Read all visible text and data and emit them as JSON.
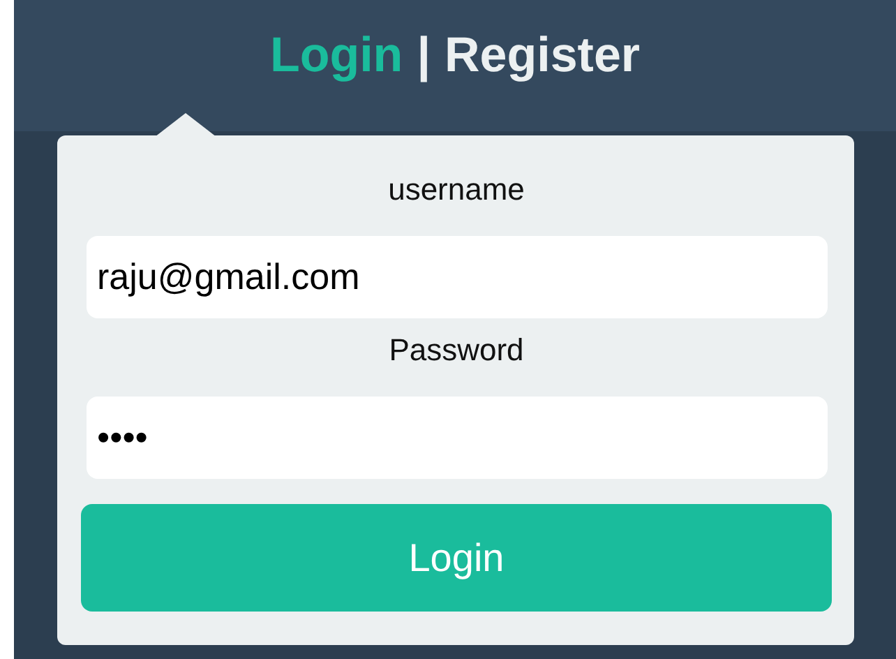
{
  "tabs": [
    {
      "label": "Login",
      "selected": true
    },
    {
      "label": "Register",
      "selected": false
    }
  ],
  "tab_separator": "|",
  "form": {
    "fields": [
      {
        "label": "username",
        "value": "raju@gmail.com"
      },
      {
        "label": "Password",
        "value": "••••"
      }
    ],
    "submit": "Login"
  }
}
